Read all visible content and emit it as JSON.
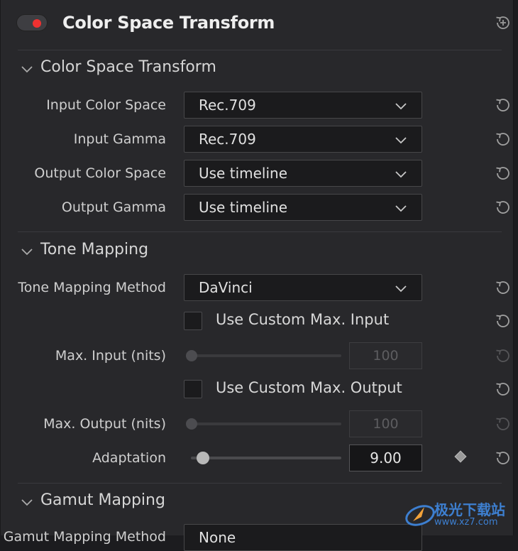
{
  "header": {
    "title": "Color Space Transform",
    "toggle_on": true,
    "toggle_color": "#ef3131",
    "reset_all_icon": "reset-plus-icon"
  },
  "sections": {
    "csf": {
      "title": "Color Space Transform",
      "rows": [
        {
          "label": "Input Color Space",
          "value": "Rec.709"
        },
        {
          "label": "Input Gamma",
          "value": "Rec.709"
        },
        {
          "label": "Output Color Space",
          "value": "Use timeline"
        },
        {
          "label": "Output Gamma",
          "value": "Use timeline"
        }
      ]
    },
    "tone": {
      "title": "Tone Mapping",
      "method_label": "Tone Mapping Method",
      "method_value": "DaVinci",
      "custom_input_label": "Use Custom Max. Input",
      "custom_input_checked": false,
      "max_input_label": "Max. Input (nits)",
      "max_input_value": "100",
      "custom_output_label": "Use Custom Max. Output",
      "custom_output_checked": false,
      "max_output_label": "Max. Output (nits)",
      "max_output_value": "100",
      "adaptation_label": "Adaptation",
      "adaptation_value": "9.00"
    },
    "gamut": {
      "title": "Gamut Mapping",
      "method_label": "Gamut Mapping Method",
      "method_value": "None"
    }
  },
  "watermark": {
    "line1": "极光下载站",
    "line2": "www.xz7.com"
  }
}
